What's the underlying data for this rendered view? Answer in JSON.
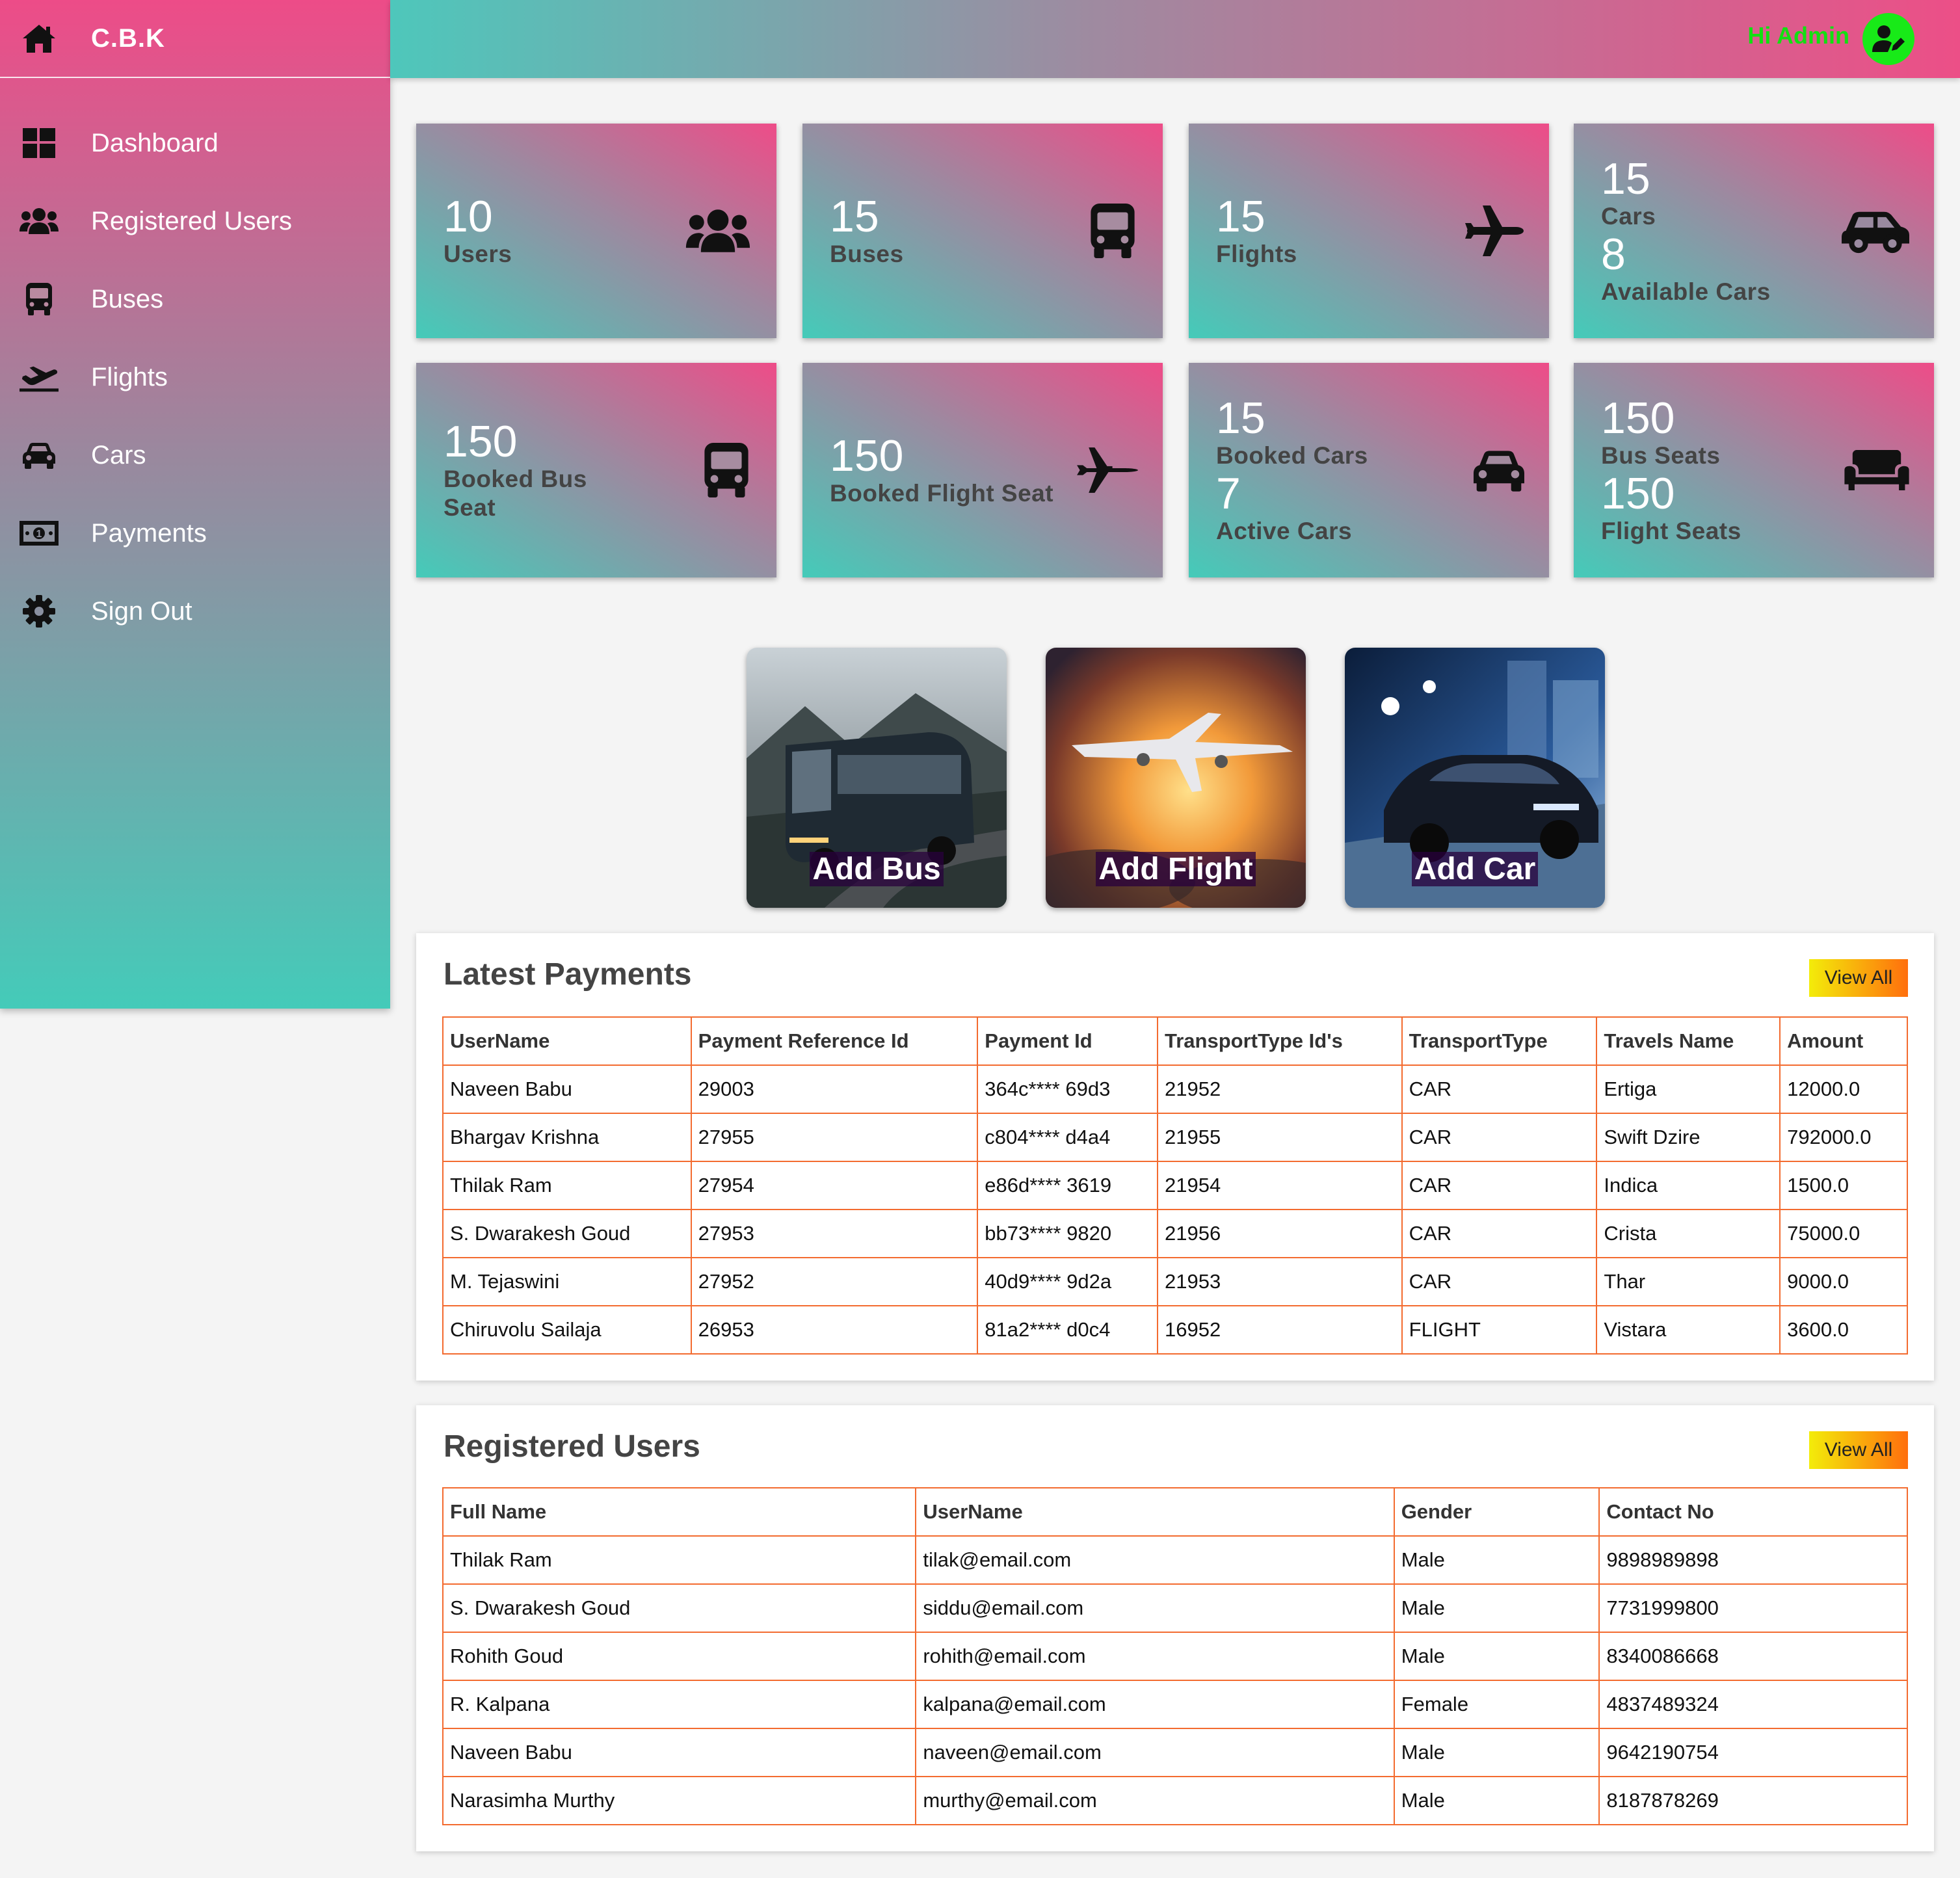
{
  "brand": {
    "name": "C.B.K",
    "icon": "home-icon"
  },
  "nav": [
    {
      "label": "Dashboard",
      "icon": "dashboard-icon"
    },
    {
      "label": "Registered Users",
      "icon": "users-icon"
    },
    {
      "label": "Buses",
      "icon": "bus-icon"
    },
    {
      "label": "Flights",
      "icon": "flight-takeoff-icon"
    },
    {
      "label": "Cars",
      "icon": "car-icon"
    },
    {
      "label": "Payments",
      "icon": "money-icon"
    },
    {
      "label": "Sign Out",
      "icon": "gear-icon"
    }
  ],
  "header": {
    "greeting": "Hi Admin",
    "avatar_icon": "user-edit-icon"
  },
  "stats": [
    {
      "num1": "10",
      "label1": "Users",
      "icon": "users-icon"
    },
    {
      "num1": "15",
      "label1": "Buses",
      "icon": "bus-icon"
    },
    {
      "num1": "15",
      "label1": "Flights",
      "icon": "plane-icon"
    },
    {
      "num1": "15",
      "label1": "Cars",
      "num2": "8",
      "label2": "Available Cars",
      "icon": "car-side-icon"
    },
    {
      "num1": "150",
      "label1": "Booked Bus Seat",
      "icon": "bus-icon"
    },
    {
      "num1": "150",
      "label1": "Booked Flight Seat",
      "icon": "fighter-jet-icon"
    },
    {
      "num1": "15",
      "label1": "Booked Cars",
      "num2": "7",
      "label2": "Active Cars",
      "icon": "car-icon"
    },
    {
      "num1": "150",
      "label1": "Bus Seats",
      "num2": "150",
      "label2": "Flight Seats",
      "icon": "couch-icon"
    }
  ],
  "actions": {
    "add_bus": "Add Bus",
    "add_flight": "Add Flight",
    "add_car": "Add Car"
  },
  "payments": {
    "title": "Latest Payments",
    "view_all": "View All",
    "columns": [
      "UserName",
      "Payment Reference Id",
      "Payment Id",
      "TransportType Id's",
      "TransportType",
      "Travels Name",
      "Amount"
    ],
    "rows": [
      [
        "Naveen Babu",
        "29003",
        "364c**** 69d3",
        "21952",
        "CAR",
        "Ertiga",
        "12000.0"
      ],
      [
        "Bhargav Krishna",
        "27955",
        "c804**** d4a4",
        "21955",
        "CAR",
        "Swift Dzire",
        "792000.0"
      ],
      [
        "Thilak Ram",
        "27954",
        "e86d**** 3619",
        "21954",
        "CAR",
        "Indica",
        "1500.0"
      ],
      [
        "S. Dwarakesh Goud",
        "27953",
        "bb73**** 9820",
        "21956",
        "CAR",
        "Crista",
        "75000.0"
      ],
      [
        "M. Tejaswini",
        "27952",
        "40d9**** 9d2a",
        "21953",
        "CAR",
        "Thar",
        "9000.0"
      ],
      [
        "Chiruvolu Sailaja",
        "26953",
        "81a2**** d0c4",
        "16952",
        "FLIGHT",
        "Vistara",
        "3600.0"
      ]
    ]
  },
  "users": {
    "title": "Registered Users",
    "view_all": "View All",
    "columns": [
      "Full Name",
      "UserName",
      "Gender",
      "Contact No"
    ],
    "rows": [
      [
        "Thilak Ram",
        "tilak@email.com",
        "Male",
        "9898989898"
      ],
      [
        "S. Dwarakesh Goud",
        "siddu@email.com",
        "Male",
        "7731999800"
      ],
      [
        "Rohith Goud",
        "rohith@email.com",
        "Male",
        "8340086668"
      ],
      [
        "R. Kalpana",
        "kalpana@email.com",
        "Female",
        "4837489324"
      ],
      [
        "Naveen Babu",
        "naveen@email.com",
        "Male",
        "9642190754"
      ],
      [
        "Narasimha Murthy",
        "murthy@email.com",
        "Male",
        "8187878269"
      ]
    ]
  }
}
